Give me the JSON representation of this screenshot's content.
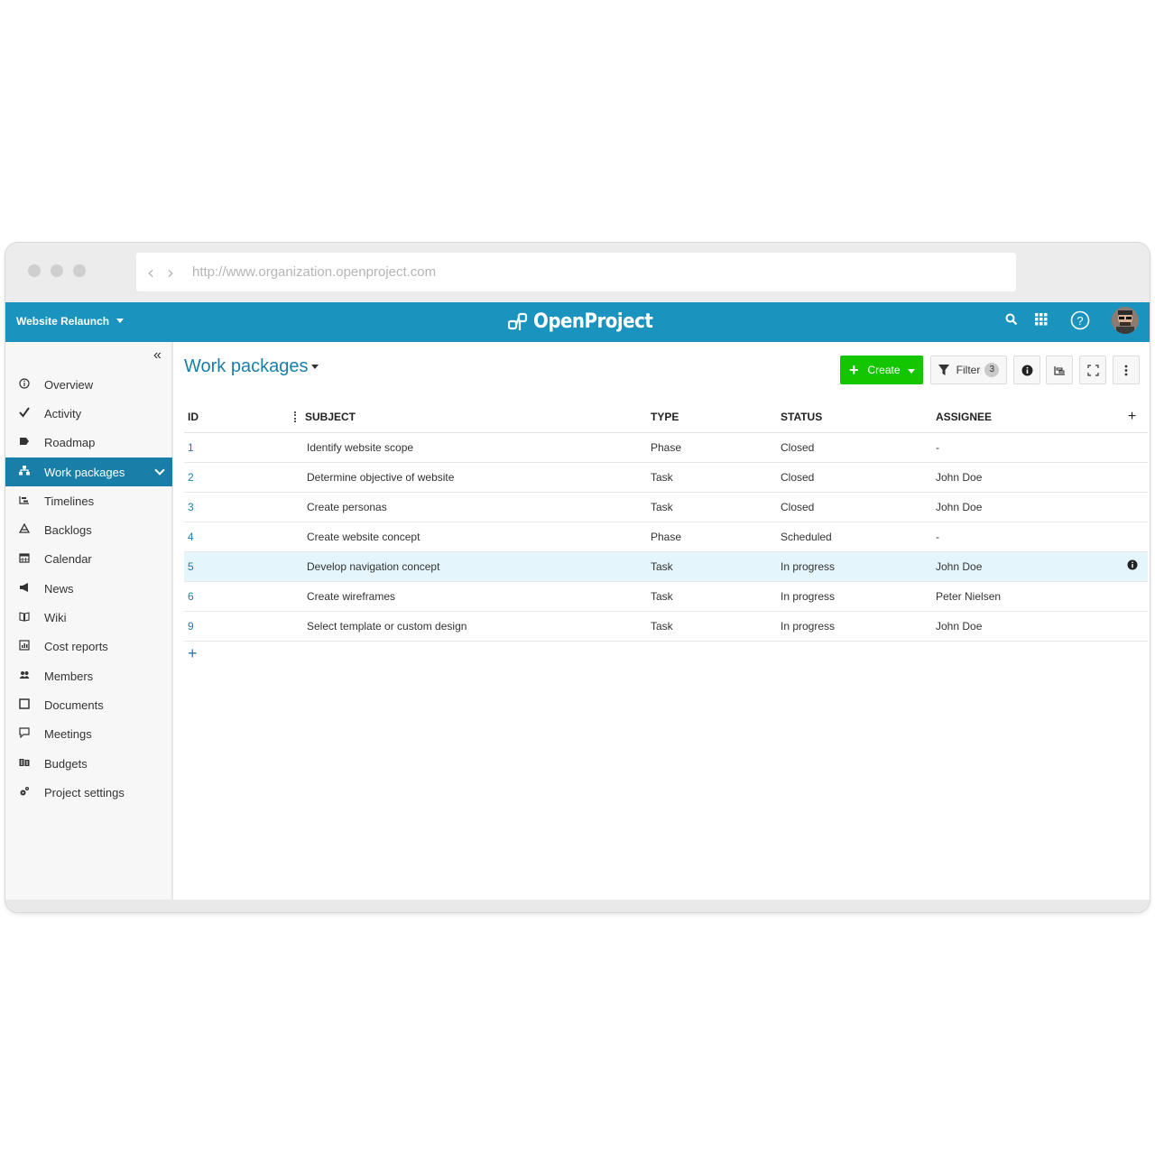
{
  "browser": {
    "url": "http://www.organization.openproject.com",
    "back_icon": "chevron-left-icon",
    "forward_icon": "chevron-right-icon"
  },
  "header": {
    "project_name": "Website Relaunch",
    "logo_text": "OpenProject",
    "brand_color": "#1a93bf"
  },
  "sidebar": {
    "items": [
      {
        "label": "Overview",
        "icon": "info-icon"
      },
      {
        "label": "Activity",
        "icon": "checkmark-icon"
      },
      {
        "label": "Roadmap",
        "icon": "tag-icon"
      },
      {
        "label": "Work packages",
        "icon": "hierarchy-icon",
        "active": true
      },
      {
        "label": "Timelines",
        "icon": "timeline-icon"
      },
      {
        "label": "Backlogs",
        "icon": "backlogs-icon"
      },
      {
        "label": "Calendar",
        "icon": "calendar-icon"
      },
      {
        "label": "News",
        "icon": "megaphone-icon"
      },
      {
        "label": "Wiki",
        "icon": "book-icon"
      },
      {
        "label": "Cost reports",
        "icon": "report-icon"
      },
      {
        "label": "Members",
        "icon": "members-icon"
      },
      {
        "label": "Documents",
        "icon": "document-icon"
      },
      {
        "label": "Meetings",
        "icon": "speech-bubble-icon"
      },
      {
        "label": "Budgets",
        "icon": "budget-icon"
      },
      {
        "label": "Project settings",
        "icon": "gears-icon"
      }
    ]
  },
  "main": {
    "title": "Work packages",
    "toolbar": {
      "create_label": "Create",
      "filter_label": "Filter",
      "filter_count": "3",
      "create_color": "#13c600"
    },
    "table": {
      "columns": [
        "ID",
        "SUBJECT",
        "TYPE",
        "STATUS",
        "ASSIGNEE"
      ],
      "rows": [
        {
          "id": "1",
          "subject": "Identify website scope",
          "type": "Phase",
          "status": "Closed",
          "assignee": "-"
        },
        {
          "id": "2",
          "subject": "Determine objective of website",
          "type": "Task",
          "status": "Closed",
          "assignee": "John Doe"
        },
        {
          "id": "3",
          "subject": "Create personas",
          "type": "Task",
          "status": "Closed",
          "assignee": "John Doe"
        },
        {
          "id": "4",
          "subject": "Create website concept",
          "type": "Phase",
          "status": "Scheduled",
          "assignee": "-"
        },
        {
          "id": "5",
          "subject": "Develop navigation concept",
          "type": "Task",
          "status": "In progress",
          "assignee": "John Doe",
          "highlighted": true
        },
        {
          "id": "6",
          "subject": "Create wireframes",
          "type": "Task",
          "status": "In progress",
          "assignee": "Peter Nielsen"
        },
        {
          "id": "9",
          "subject": "Select template or custom design",
          "type": "Task",
          "status": "In progress",
          "assignee": "John Doe"
        }
      ]
    }
  }
}
